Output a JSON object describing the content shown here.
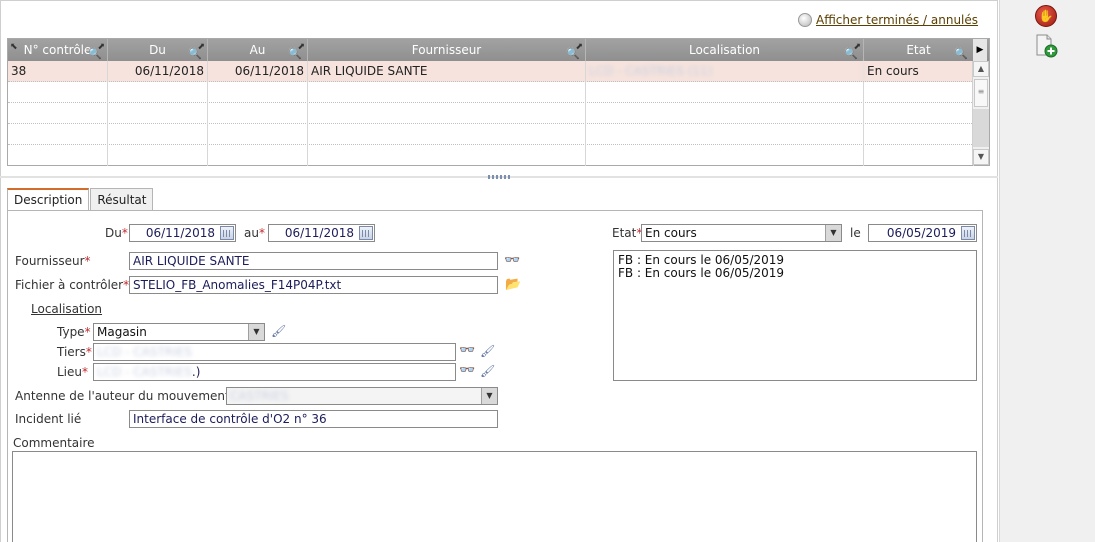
{
  "top": {
    "show_finished_label": "Afficher terminés / annulés"
  },
  "grid": {
    "headers": [
      "N° contrôle",
      "Du",
      "Au",
      "Fournisseur",
      "Localisation",
      "Etat"
    ],
    "rows": [
      {
        "no": "38",
        "du": "06/11/2018",
        "au": "06/11/2018",
        "fournisseur": "AIR LIQUIDE SANTE",
        "localisation": "LCD - CASTRIES (11)",
        "etat": "En cours"
      }
    ]
  },
  "tabs": [
    {
      "label": "Description",
      "active": true
    },
    {
      "label": "Résultat",
      "active": false
    }
  ],
  "form": {
    "du_label": "Du",
    "du_value": "06/11/2018",
    "au_label": "au",
    "au_value": "06/11/2018",
    "fournisseur_label": "Fournisseur",
    "fournisseur_value": "AIR LIQUIDE SANTE",
    "fichier_label": "Fichier à contrôler",
    "fichier_value": "STELIO_FB_Anomalies_F14P04P.txt",
    "localisation_label": "Localisation",
    "type_label": "Type",
    "type_value": "Magasin",
    "tiers_label": "Tiers",
    "tiers_value": "LCD - CASTRIES",
    "lieu_label": "Lieu",
    "lieu_value": "LCD - CASTRIES",
    "lieu_suffix": ".)",
    "antenne_label": "Antenne de l'auteur du mouvement",
    "antenne_value": "CASTRIES",
    "incident_label": "Incident lié",
    "incident_value": "Interface de contrôle d'O2 n° 36",
    "commentaire_label": "Commentaire",
    "etat_label": "Etat",
    "etat_value": "En cours",
    "le_label": "le",
    "le_value": "06/05/2019",
    "state_history": [
      "FB : En cours le 06/05/2019",
      "FB : En cours le 06/05/2019"
    ]
  },
  "required_mark": "*"
}
